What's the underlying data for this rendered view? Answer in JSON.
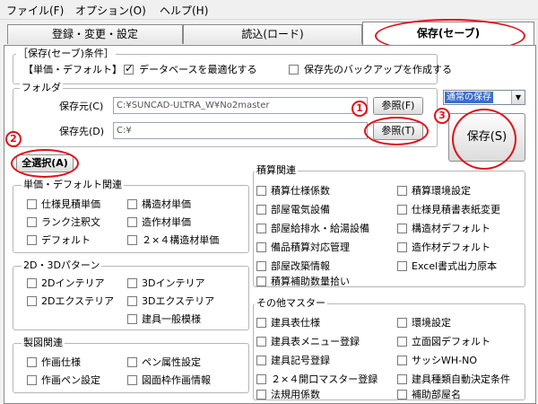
{
  "menu": {
    "file": "ファイル(F)",
    "options": "オプション(O)",
    "help": "ヘルプ(H)"
  },
  "tabs": [
    {
      "label": "登録・変更・設定"
    },
    {
      "label": "読込(ロード)"
    },
    {
      "label": "保存(セーブ)"
    }
  ],
  "save_conditions": {
    "title": "［保存(セーブ)条件］",
    "unit_label": "【単価・デフォルト】",
    "optimize_db": {
      "label": "データベースを最適化する",
      "checked": true
    },
    "backup": {
      "label": "保存先のバックアップを作成する",
      "checked": false
    }
  },
  "folder": {
    "title": "フォルダ",
    "source_label": "保存元(C)",
    "source_value": "C:¥SUNCAD-ULTRA_W¥No2master",
    "dest_label": "保存先(D)",
    "dest_value": "C:¥",
    "browse_f": "参照(F)",
    "browse_t": "参照(T)"
  },
  "save_mode": {
    "value": "通常の保存"
  },
  "save_button": "保存(S)",
  "select_all": "全選択(A)",
  "callouts": {
    "one": "1",
    "two": "2",
    "three": "3"
  },
  "groups": {
    "unit_price": {
      "title": "単価・デフォルト関連",
      "items": [
        "仕様見積単価",
        "構造材単価",
        "ランク注釈文",
        "造作材単価",
        "デフォルト",
        "２×４構造材単価"
      ]
    },
    "pattern": {
      "title": "2D・3Dパターン",
      "items": [
        "2Dインテリア",
        "3Dインテリア",
        "2Dエクステリア",
        "3Dエクステリア",
        "建具一般模様"
      ]
    },
    "drafting": {
      "title": "製図関連",
      "items": [
        "作画仕様",
        "ペン属性設定",
        "作画ペン設定",
        "図面枠作画情報"
      ]
    },
    "estimate": {
      "title": "積算関連",
      "items": [
        "積算仕様係数",
        "積算環境設定",
        "部屋電気設備",
        "仕様見積書表紙変更",
        "部屋給排水・給湯設備",
        "構造材デフォルト",
        "備品積算対応管理",
        "造作材デフォルト",
        "部屋改築情報",
        "Excel書式出力原本",
        "積算補助数量拾い"
      ]
    },
    "other_master": {
      "title": "その他マスター",
      "items": [
        "建具表仕様",
        "環境設定",
        "建具表メニュー登録",
        "立面図デフォルト",
        "建具記号登録",
        "サッシWH-NO",
        "２×４開口マスター登録",
        "建具種類自動決定条件",
        "法規用係数",
        "補助部屋名"
      ]
    }
  },
  "colors": {
    "accent_red": "#e0101a",
    "selection_blue": "#3a6fc9"
  }
}
